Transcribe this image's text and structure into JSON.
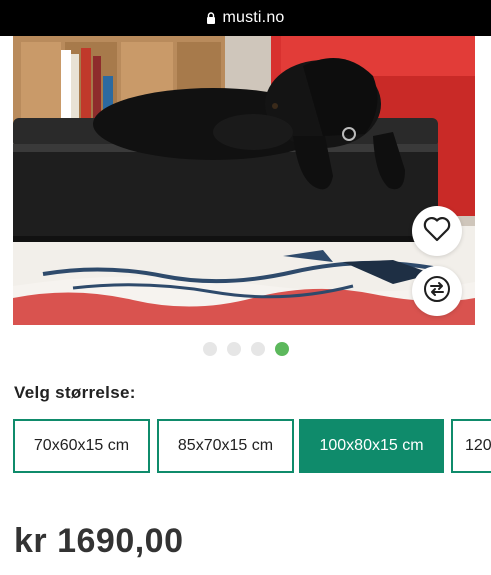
{
  "browser": {
    "url": "musti.no",
    "lock_icon": "lock-icon"
  },
  "gallery": {
    "image_alt": "black-dog-on-leather-bed",
    "dot_count": 4,
    "active_dot": 4,
    "favorite_icon": "heart-icon",
    "compare_icon": "compare-arrows-icon"
  },
  "size_selector": {
    "label": "Velg størrelse:",
    "options": [
      "70x60x15 cm",
      "85x70x15 cm",
      "100x80x15 cm",
      "120"
    ],
    "selected": "100x80x15 cm",
    "accent_color": "#0f8b6b"
  },
  "price": {
    "text": "kr 1690,00"
  }
}
